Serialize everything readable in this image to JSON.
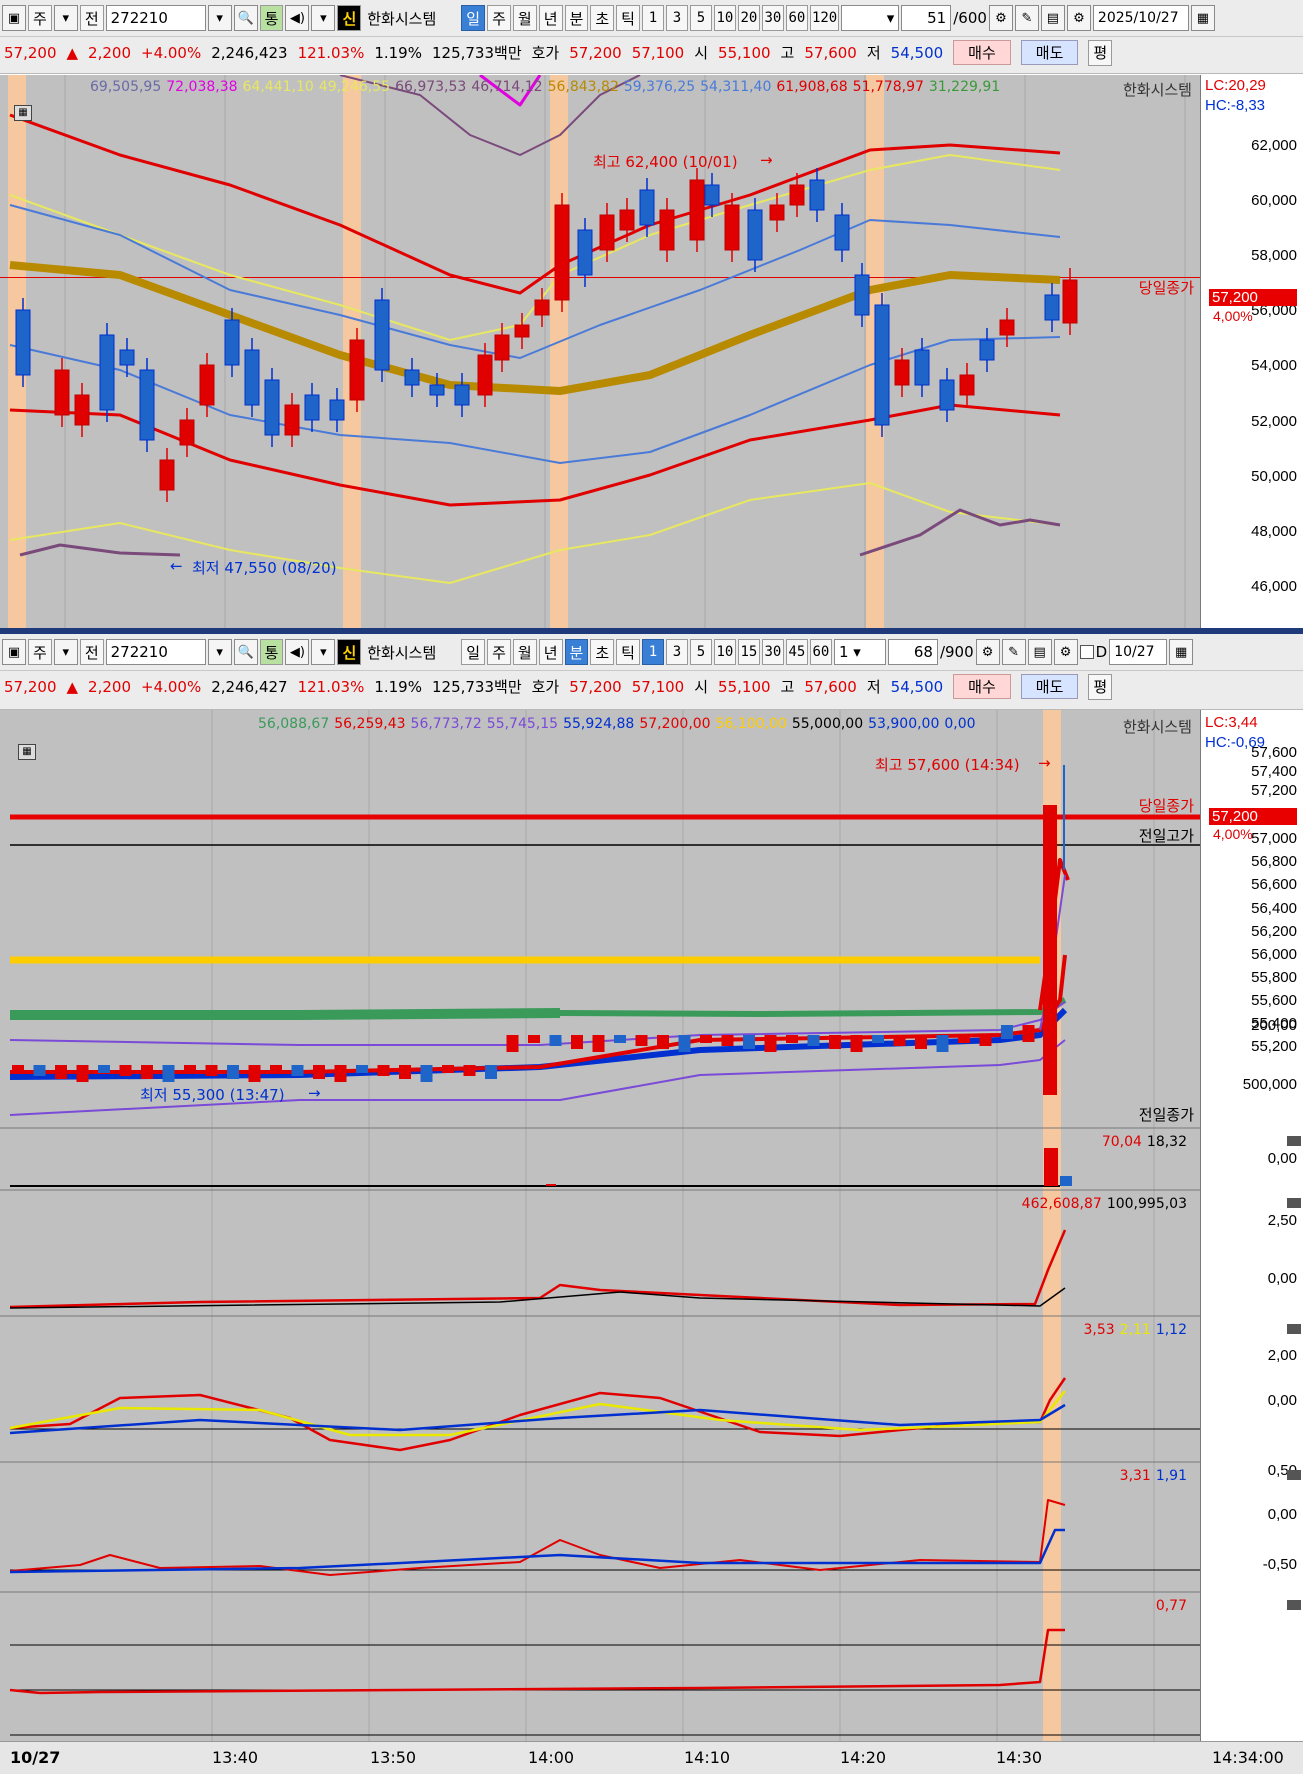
{
  "top_toolbar": {
    "prefix_btn": "주",
    "prev_btn": "전",
    "code": "272210",
    "flag_badge": "통",
    "shin_badge": "신",
    "name": "한화시스템",
    "periods": [
      "일",
      "주",
      "월",
      "년",
      "분",
      "초",
      "틱"
    ],
    "selected_period": "일",
    "mins": [
      "1",
      "3",
      "5",
      "10",
      "20",
      "30",
      "60",
      "120"
    ],
    "count": "51",
    "count_total": "/600",
    "date": "2025/10/27"
  },
  "top_info": {
    "price": "57,200",
    "change": "2,200",
    "rate": "+4.00%",
    "volume": "2,246,423",
    "vol_ratio": "121.03%",
    "turnover": "1.19%",
    "amount": "125,733백만",
    "hoga_label": "호가",
    "ask": "57,200",
    "bid": "57,100",
    "open_label": "시",
    "open": "55,100",
    "high_label": "고",
    "high": "57,600",
    "low_label": "저",
    "low": "54,500",
    "buy": "매수",
    "sell": "매도",
    "flat": "평"
  },
  "top_chart": {
    "legend": [
      {
        "text": "69,505,95",
        "color": "#6a6aa8"
      },
      {
        "text": "72,038,38",
        "color": "#e000e0"
      },
      {
        "text": "64,441,10",
        "color": "#e8e860"
      },
      {
        "text": "49,246,55",
        "color": "#e8e860"
      },
      {
        "text": "66,973,53",
        "color": "#7a4a7a"
      },
      {
        "text": "46,714,12",
        "color": "#7a4a7a"
      },
      {
        "text": "56,843,82",
        "color": "#b88a00"
      },
      {
        "text": "59,376,25",
        "color": "#4a7ad8"
      },
      {
        "text": "54,311,40",
        "color": "#4a7ad8"
      },
      {
        "text": "61,908,68",
        "color": "#e00000"
      },
      {
        "text": "51,778,97",
        "color": "#e00000"
      },
      {
        "text": "31,229,91",
        "color": "#3a9a3a"
      }
    ],
    "name_label": "한화시스템",
    "lc": "LC:20,29",
    "hc": "HC:-8,33",
    "high_label": "최고 62,400 (10/01)",
    "low_label": "최저 47,550 (08/20)",
    "close_label": "당일종가",
    "price_box": "57,200",
    "pct_label": "4,00%",
    "axis_ticks": [
      "62,000",
      "60,000",
      "58,000",
      "56,000",
      "54,000",
      "52,000",
      "50,000",
      "48,000",
      "46,000"
    ]
  },
  "bottom_toolbar": {
    "prefix_btn": "주",
    "prev_btn": "전",
    "code": "272210",
    "flag_badge": "통",
    "shin_badge": "신",
    "name": "한화시스템",
    "periods": [
      "일",
      "주",
      "월",
      "년",
      "분",
      "초",
      "틱"
    ],
    "selected_period": "분",
    "mins": [
      "1",
      "3",
      "5",
      "10",
      "15",
      "30",
      "45",
      "60"
    ],
    "selected_min": "1",
    "unit": "1",
    "count": "68",
    "count_total": "/900",
    "check_label": "D",
    "date": "10/27"
  },
  "bottom_info": {
    "price": "57,200",
    "change": "2,200",
    "rate": "+4.00%",
    "volume": "2,246,427",
    "vol_ratio": "121.03%",
    "turnover": "1.19%",
    "amount": "125,733백만",
    "hoga_label": "호가",
    "ask": "57,200",
    "bid": "57,100",
    "open_label": "시",
    "open": "55,100",
    "high_label": "고",
    "high": "57,600",
    "low_label": "저",
    "low": "54,500",
    "buy": "매수",
    "sell": "매도",
    "flat": "평"
  },
  "bottom_chart": {
    "legend": [
      {
        "text": "56,088,67",
        "color": "#3a9a5a"
      },
      {
        "text": "56,259,43",
        "color": "#e00000"
      },
      {
        "text": "56,773,72",
        "color": "#7a4ad8"
      },
      {
        "text": "55,745,15",
        "color": "#7a4ad8"
      },
      {
        "text": "55,924,88",
        "color": "#0030d0"
      },
      {
        "text": "57,200,00",
        "color": "#e00000"
      },
      {
        "text": "56,100,00",
        "color": "#ffcc00"
      },
      {
        "text": "55,000,00",
        "color": "#000000"
      },
      {
        "text": "53,900,00",
        "color": "#0030d0"
      },
      {
        "text": "0,00",
        "color": "#0030d0"
      }
    ],
    "name_label": "한화시스템",
    "lc": "LC:3,44",
    "hc": "HC:-0,69",
    "high_label": "최고 57,600 (14:34)",
    "low_label": "최저 55,300 (13:47)",
    "close_label": "당일종가",
    "prev_high_label": "전일고가",
    "prev_close_label": "전일종가",
    "price_box": "57,200",
    "pct_label": "4,00%",
    "axis_ticks": [
      "57,600",
      "57,400",
      "57,200",
      "57,000",
      "56,800",
      "56,600",
      "56,400",
      "56,200",
      "56,000",
      "55,800",
      "55,600",
      "55,400",
      "55,200"
    ]
  },
  "sub1": {
    "legend": [
      {
        "text": "70,04",
        "color": "#e00000"
      },
      {
        "text": "18,32",
        "color": "#000000"
      }
    ],
    "axis_ticks": [
      "200,00"
    ]
  },
  "sub2": {
    "legend": [
      {
        "text": "462,608,87",
        "color": "#e00000"
      },
      {
        "text": "100,995,03",
        "color": "#000000"
      }
    ],
    "axis_ticks": [
      "500,000",
      "0,00"
    ]
  },
  "sub3": {
    "legend": [
      {
        "text": "3,53",
        "color": "#e00000"
      },
      {
        "text": "2,11",
        "color": "#e8e800"
      },
      {
        "text": "1,12",
        "color": "#0030d0"
      }
    ],
    "axis_ticks": [
      "2,50",
      "0,00"
    ]
  },
  "sub4": {
    "legend": [
      {
        "text": "3,31",
        "color": "#e00000"
      },
      {
        "text": "1,91",
        "color": "#0030d0"
      }
    ],
    "axis_ticks": [
      "2,00",
      "0,00"
    ]
  },
  "sub5": {
    "legend": [
      {
        "text": "0,77",
        "color": "#e00000"
      }
    ],
    "axis_ticks": [
      "0,50",
      "0,00",
      "-0,50"
    ]
  },
  "x_axis": {
    "labels": [
      "10/27",
      "13:40",
      "13:50",
      "14:00",
      "14:10",
      "14:20",
      "14:30",
      "14:34:00"
    ]
  }
}
